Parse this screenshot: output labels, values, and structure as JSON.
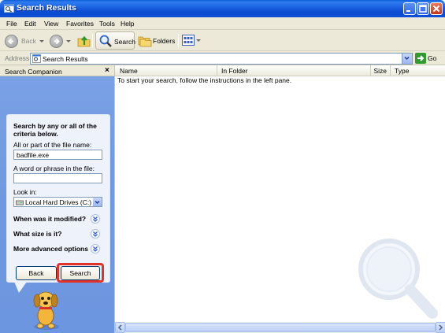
{
  "window": {
    "title": "Search Results"
  },
  "menu": {
    "items": [
      "File",
      "Edit",
      "View",
      "Favorites",
      "Tools",
      "Help"
    ]
  },
  "toolbar": {
    "back_label": "Back",
    "search_label": "Search",
    "folders_label": "Folders"
  },
  "address": {
    "label": "Address",
    "value": "Search Results",
    "go_label": "Go"
  },
  "companion": {
    "title": "Search Companion",
    "criteria_title": "Search by any or all of the criteria below.",
    "filename_label": "All or part of the file name:",
    "filename_value": "badfile.exe",
    "phrase_label": "A word or phrase in the file:",
    "phrase_value": "",
    "lookin_label": "Look in:",
    "lookin_value": "Local Hard Drives (C:)",
    "when_modified": "When was it modified?",
    "what_size": "What size is it?",
    "advanced": "More advanced options",
    "back_button": "Back",
    "search_button": "Search"
  },
  "results": {
    "columns": [
      "Name",
      "In Folder",
      "Size",
      "Type"
    ],
    "message": "To start your search, follow the instructions in the left pane."
  },
  "colors": {
    "title_blue": "#0b4bd0",
    "pane_blue": "#6f98e0",
    "highlight_red": "#e2332a"
  }
}
